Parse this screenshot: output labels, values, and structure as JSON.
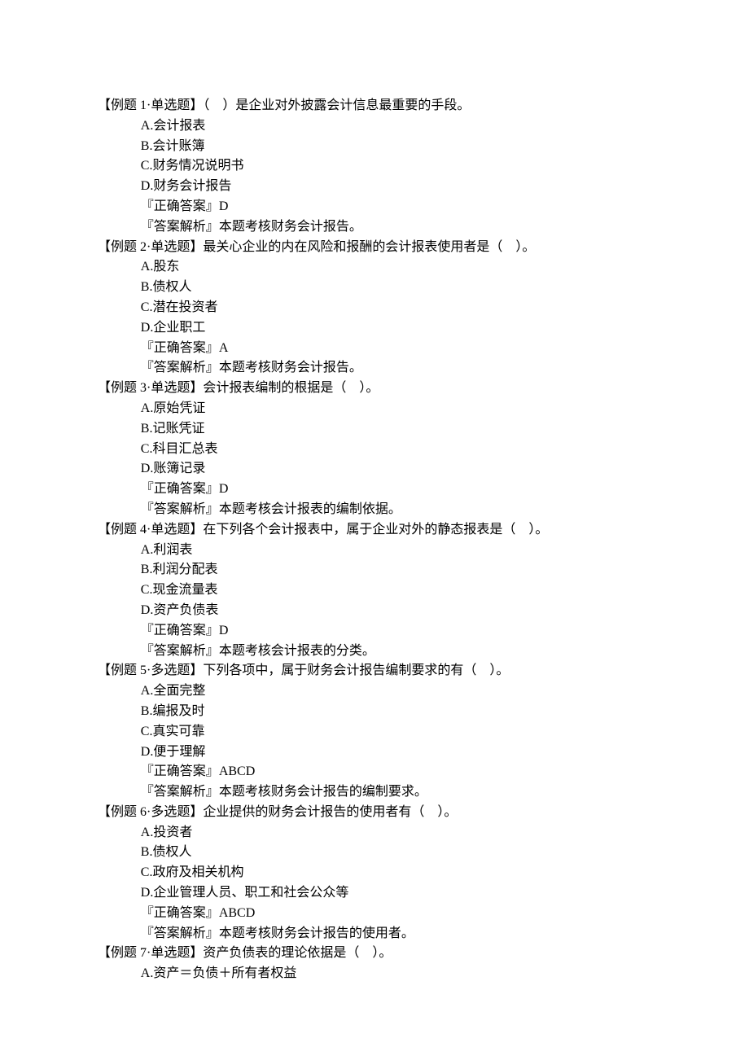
{
  "questions": [
    {
      "tag": "【例题 1·单选题】",
      "stem": "（　）是企业对外披露会计信息最重要的手段。",
      "options": [
        "A.会计报表",
        "B.会计账簿",
        "C.财务情况说明书",
        "D.财务会计报告"
      ],
      "answer_label": "『正确答案』",
      "answer": "D",
      "analysis_label": "『答案解析』",
      "analysis": "本题考核财务会计报告。"
    },
    {
      "tag": "【例题 2·单选题】",
      "stem": "最关心企业的内在风险和报酬的会计报表使用者是（　）。",
      "options": [
        "A.股东",
        "B.债权人",
        "C.潜在投资者",
        "D.企业职工"
      ],
      "answer_label": "『正确答案』",
      "answer": "A",
      "analysis_label": "『答案解析』",
      "analysis": "本题考核财务会计报告。"
    },
    {
      "tag": "【例题 3·单选题】",
      "stem": "会计报表编制的根据是（　）。",
      "options": [
        "A.原始凭证",
        "B.记账凭证",
        "C.科目汇总表",
        "D.账簿记录"
      ],
      "answer_label": "『正确答案』",
      "answer": "D",
      "analysis_label": "『答案解析』",
      "analysis": "本题考核会计报表的编制依据。"
    },
    {
      "tag": "【例题 4·单选题】",
      "stem": "在下列各个会计报表中，属于企业对外的静态报表是（　）。",
      "options": [
        "A.利润表",
        "B.利润分配表",
        "C.现金流量表",
        "D.资产负债表"
      ],
      "answer_label": "『正确答案』",
      "answer": "D",
      "analysis_label": "『答案解析』",
      "analysis": "本题考核会计报表的分类。"
    },
    {
      "tag": "【例题 5·多选题】",
      "stem": "下列各项中，属于财务会计报告编制要求的有（　）。",
      "options": [
        "A.全面完整",
        "B.编报及时",
        "C.真实可靠",
        "D.便于理解"
      ],
      "answer_label": "『正确答案』",
      "answer": "ABCD",
      "analysis_label": "『答案解析』",
      "analysis": "本题考核财务会计报告的编制要求。"
    },
    {
      "tag": "【例题 6·多选题】",
      "stem": "企业提供的财务会计报告的使用者有（　）。",
      "options": [
        "A.投资者",
        "B.债权人",
        "C.政府及相关机构",
        "D.企业管理人员、职工和社会公众等"
      ],
      "answer_label": "『正确答案』",
      "answer": "ABCD",
      "analysis_label": "『答案解析』",
      "analysis": "本题考核财务会计报告的使用者。"
    },
    {
      "tag": "【例题 7·单选题】",
      "stem": "资产负债表的理论依据是（　）。",
      "options": [
        "A.资产＝负债＋所有者权益"
      ],
      "answer_label": "",
      "answer": "",
      "analysis_label": "",
      "analysis": ""
    }
  ]
}
